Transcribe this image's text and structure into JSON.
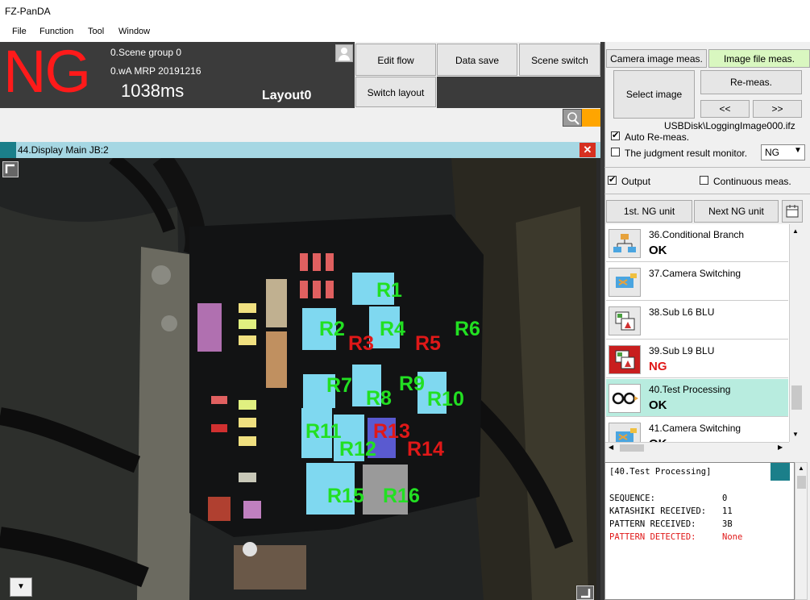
{
  "window": {
    "title": "FZ-PanDA"
  },
  "menu": [
    "File",
    "Function",
    "Tool",
    "Window"
  ],
  "status": {
    "judgement": "NG",
    "scene_group": "0.Scene group 0",
    "scene_name": "0.wA MRP 20191216",
    "time": "1038ms",
    "layout": "Layout0"
  },
  "toolbar": {
    "edit_flow": "Edit flow",
    "data_save": "Data save",
    "scene_switch": "Scene switch",
    "switch_layout": "Switch layout"
  },
  "image_window": {
    "title": "44.Display Main JB:2",
    "labels": [
      {
        "text": "R1",
        "status": "OK"
      },
      {
        "text": "R2",
        "status": "OK"
      },
      {
        "text": "R3",
        "status": "NG"
      },
      {
        "text": "R4",
        "status": "OK"
      },
      {
        "text": "R5",
        "status": "NG"
      },
      {
        "text": "R6",
        "status": "OK"
      },
      {
        "text": "R7",
        "status": "OK"
      },
      {
        "text": "R8",
        "status": "OK"
      },
      {
        "text": "R9",
        "status": "OK"
      },
      {
        "text": "R10",
        "status": "OK"
      },
      {
        "text": "R11",
        "status": "OK"
      },
      {
        "text": "R12",
        "status": "OK"
      },
      {
        "text": "R13",
        "status": "NG"
      },
      {
        "text": "R14",
        "status": "NG"
      },
      {
        "text": "R15",
        "status": "OK"
      },
      {
        "text": "R16",
        "status": "OK"
      }
    ]
  },
  "right_panel": {
    "tab_camera": "Camera image meas.",
    "tab_file": "Image file meas.",
    "select_image": "Select image",
    "remeas": "Re-meas.",
    "prev": "<<",
    "next": ">>",
    "file_path": "USBDisk\\LoggingImage000.ifz",
    "auto_remeas": "Auto Re-meas.",
    "judgment_monitor": "The judgment result monitor.",
    "judgment_select": "NG",
    "output": "Output",
    "continuous": "Continuous meas.",
    "first_ng": "1st. NG unit",
    "next_ng": "Next NG unit"
  },
  "units": [
    {
      "name": "36.Conditional Branch",
      "result": "OK",
      "icon": "flow-branch-icon"
    },
    {
      "name": "37.Camera Switching",
      "result": "",
      "icon": "camera-switch-icon"
    },
    {
      "name": "38.Sub L6 BLU",
      "result": "",
      "icon": "sub-unit-icon"
    },
    {
      "name": "39.Sub L9 BLU",
      "result": "NG",
      "icon": "sub-unit-icon"
    },
    {
      "name": "40.Test Processing",
      "result": "OK",
      "icon": "glasses-icon"
    },
    {
      "name": "41.Camera Switching",
      "result": "OK",
      "icon": "camera-switch-icon"
    }
  ],
  "log": {
    "header": "[40.Test Processing]",
    "lines": [
      {
        "key": "SEQUENCE:",
        "value": "0"
      },
      {
        "key": "KATASHIKI RECEIVED:",
        "value": "11"
      },
      {
        "key": "PATTERN RECEIVED:",
        "value": "3B"
      },
      {
        "key": "PATTERN DETECTED:",
        "value": "None"
      }
    ]
  },
  "colors": {
    "ok_green": "#22e022",
    "ng_red": "#e01818",
    "active_tab": "#d9f7c0",
    "selected_row": "#b8ecdf",
    "ng_icon_bg": "#c81e1e"
  }
}
